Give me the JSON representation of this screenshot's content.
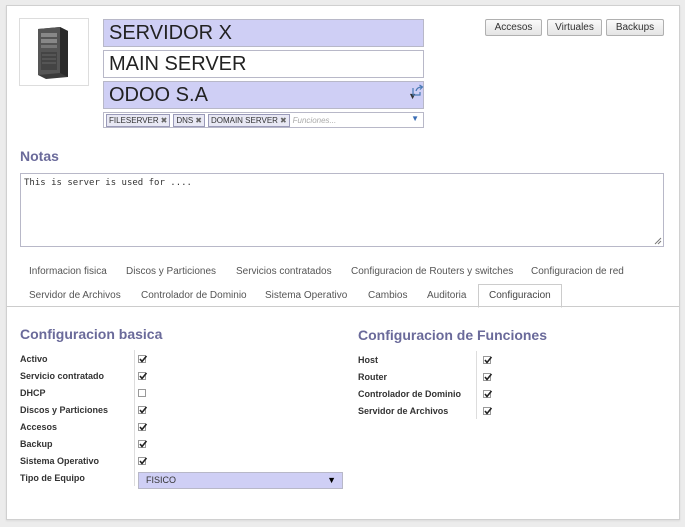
{
  "header": {
    "name": "SERVIDOR X",
    "description": "MAIN SERVER",
    "company": "ODOO S.A",
    "tags": [
      "FILESERVER",
      "DNS",
      "DOMAIN SERVER"
    ],
    "tags_placeholder": "Funciones...",
    "image_icon": "server-tower-icon"
  },
  "buttons": {
    "accesos": "Accesos",
    "virtuales": "Virtuales",
    "backups": "Backups"
  },
  "notes": {
    "title": "Notas",
    "text": "This is server is used for ...."
  },
  "tabs": [
    [
      "Informacion fisica",
      "Discos y Particiones",
      "Servicios contratados",
      "Configuracion de Routers y switches",
      "Configuracion de red"
    ],
    [
      "Servidor de Archivos",
      "Controlador de Dominio",
      "Sistema Operativo",
      "Cambios",
      "Auditoria",
      "Configuracion"
    ]
  ],
  "active_tab": "Configuracion",
  "config_basica": {
    "title": "Configuracion basica",
    "rows": [
      {
        "label": "Activo",
        "checked": true
      },
      {
        "label": "Servicio contratado",
        "checked": true
      },
      {
        "label": "DHCP",
        "checked": false
      },
      {
        "label": "Discos y Particiones",
        "checked": true
      },
      {
        "label": "Accesos",
        "checked": true
      },
      {
        "label": "Backup",
        "checked": true
      },
      {
        "label": "Sistema Operativo",
        "checked": true
      }
    ],
    "tipo_label": "Tipo de Equipo",
    "tipo_value": "FISICO"
  },
  "config_funciones": {
    "title": "Configuracion de Funciones",
    "rows": [
      {
        "label": "Host",
        "checked": true
      },
      {
        "label": "Router",
        "checked": true
      },
      {
        "label": "Controlador de Dominio",
        "checked": true
      },
      {
        "label": "Servidor de Archivos",
        "checked": true
      }
    ]
  },
  "colors": {
    "accent": "#6a6a9a",
    "required_field": "#cfcff5"
  }
}
